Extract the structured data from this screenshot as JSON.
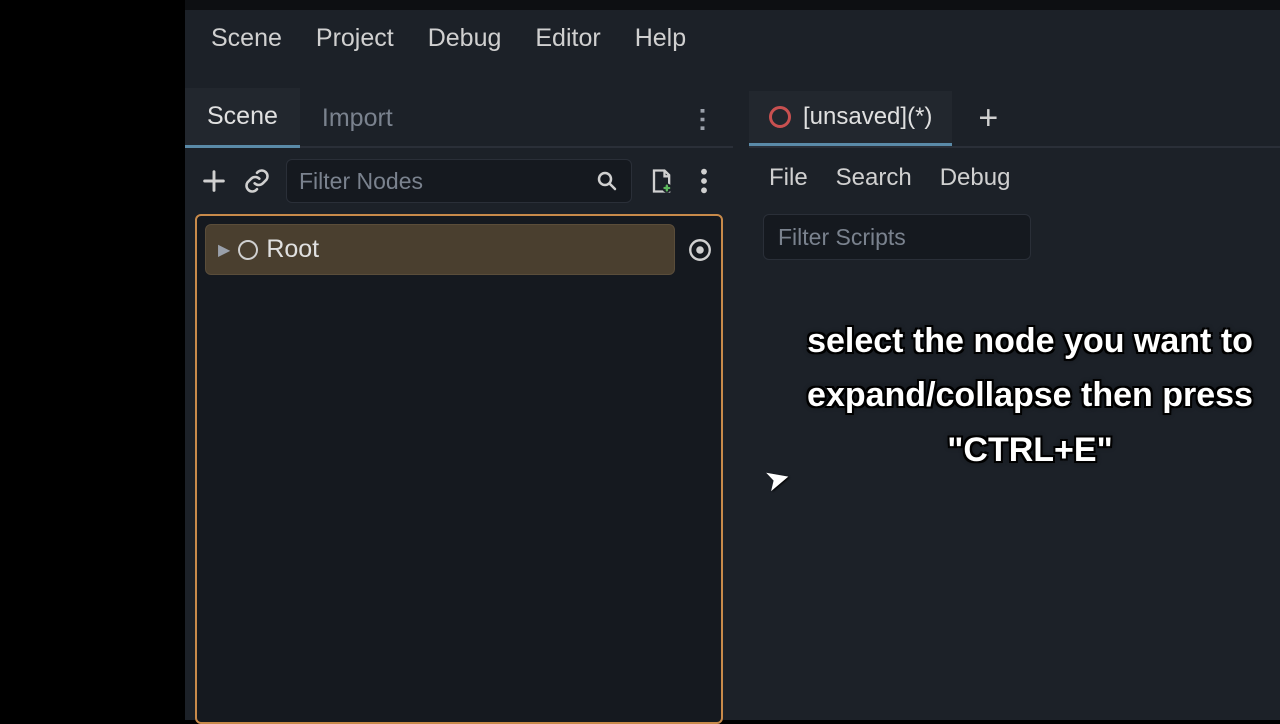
{
  "menu": {
    "items": [
      "Scene",
      "Project",
      "Debug",
      "Editor",
      "Help"
    ]
  },
  "scene_panel": {
    "tabs": {
      "active": "Scene",
      "inactive": "Import"
    },
    "filter_placeholder": "Filter Nodes",
    "root_label": "Root"
  },
  "script_panel": {
    "tab_label": "[unsaved](*)",
    "menu": [
      "File",
      "Search",
      "Debug"
    ],
    "filter_placeholder": "Filter Scripts"
  },
  "caption": "select the node you want to expand/collapse then press \"CTRL+E\""
}
